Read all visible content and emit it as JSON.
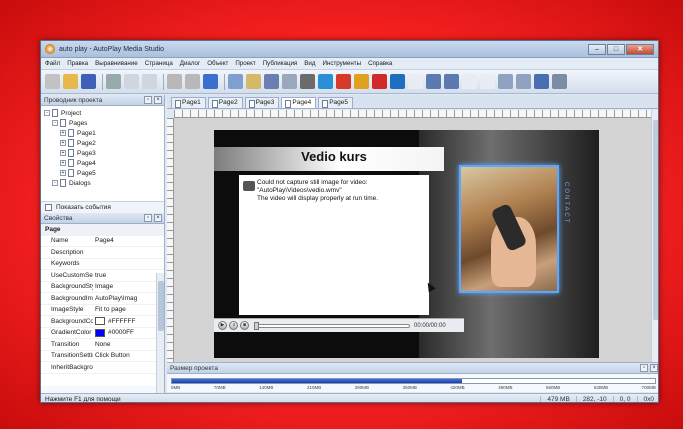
{
  "window": {
    "title": "auto play - AutoPlay Media Studio",
    "controls": {
      "minimize": "–",
      "maximize": "□",
      "close": "✕"
    }
  },
  "menu": [
    "Файл",
    "Правка",
    "Выравнивание",
    "Страница",
    "Диалог",
    "Объект",
    "Проект",
    "Публикация",
    "Вид",
    "Инструменты",
    "Справка"
  ],
  "toolbar_icons": [
    {
      "name": "wand-icon",
      "color": "#c2c2c2"
    },
    {
      "name": "open-folder-icon",
      "color": "#e8b84a"
    },
    {
      "name": "save-icon",
      "color": "#3e60b8"
    },
    {
      "name": "cut-icon",
      "color": "#9aa"
    },
    {
      "name": "copy-icon",
      "color": "#cfd6e0"
    },
    {
      "name": "paste-icon",
      "color": "#cfd6e0"
    },
    {
      "name": "undo-icon",
      "color": "#b8b8b8"
    },
    {
      "name": "redo-icon",
      "color": "#b8b8b8"
    },
    {
      "name": "preview-icon",
      "color": "#3a6fd0"
    },
    {
      "name": "button-object-icon",
      "color": "#7fa0cf"
    },
    {
      "name": "label-object-icon",
      "color": "#d6b86a"
    },
    {
      "name": "text-object-icon",
      "color": "#6a7fb0"
    },
    {
      "name": "paragraph-object-icon",
      "color": "#9aa8bd"
    },
    {
      "name": "plugin-object-icon",
      "color": "#6b6b6b"
    },
    {
      "name": "web-object-icon",
      "color": "#2b8fd8"
    },
    {
      "name": "flash-object-icon",
      "color": "#d83a2a"
    },
    {
      "name": "media-object-icon",
      "color": "#e0a020"
    },
    {
      "name": "pdf-object-icon",
      "color": "#d02a2a"
    },
    {
      "name": "ie-object-icon",
      "color": "#1f6fc0"
    },
    {
      "name": "input-object-icon",
      "color": "#e8edf4"
    },
    {
      "name": "checkbox-object-icon",
      "color": "#5a7ab0"
    },
    {
      "name": "radio-object-icon",
      "color": "#5a7ab0"
    },
    {
      "name": "list-object-icon",
      "color": "#e8edf4"
    },
    {
      "name": "combo-object-icon",
      "color": "#e8edf4"
    },
    {
      "name": "tree-object-icon",
      "color": "#8fa3c0"
    },
    {
      "name": "grid-object-icon",
      "color": "#8fa3c0"
    },
    {
      "name": "progress-object-icon",
      "color": "#4a6fb0"
    },
    {
      "name": "slideshow-object-icon",
      "color": "#7c8ca6"
    }
  ],
  "project_explorer": {
    "header": "Проводник проекта",
    "tree": [
      {
        "label": "Project",
        "level": 0
      },
      {
        "label": "Pages",
        "level": 1
      },
      {
        "label": "Page1",
        "level": 2
      },
      {
        "label": "Page2",
        "level": 2
      },
      {
        "label": "Page3",
        "level": 2
      },
      {
        "label": "Page4",
        "level": 2
      },
      {
        "label": "Page5",
        "level": 2
      },
      {
        "label": "Dialogs",
        "level": 1
      }
    ],
    "show_events": "Показать события"
  },
  "properties": {
    "header": "Свойства",
    "group": "Page",
    "rows": [
      {
        "name": "Name",
        "value": "Page4"
      },
      {
        "name": "Description",
        "value": ""
      },
      {
        "name": "Keywords",
        "value": ""
      },
      {
        "name": "UseCustomSett",
        "value": "true"
      },
      {
        "name": "BackgroundStyl",
        "value": "Image"
      },
      {
        "name": "BackgroundIma",
        "value": "AutoPlay\\Imag"
      },
      {
        "name": "ImageStyle",
        "value": "Fit to page"
      },
      {
        "name": "BackgroundCol",
        "value": "#FFFFFF",
        "swatch": "#FFFFFF"
      },
      {
        "name": "GradientColor",
        "value": "#0000FF",
        "swatch": "#0000FF"
      },
      {
        "name": "Transition",
        "value": "None"
      },
      {
        "name": "TransitionSettin",
        "value": "Click Button"
      },
      {
        "name": "InheritBackgrou",
        "value": ""
      }
    ]
  },
  "tabs": [
    "Page1",
    "Page2",
    "Page3",
    "Page4",
    "Page5"
  ],
  "active_tab": "Page4",
  "page_preview": {
    "title": "Vedio kurs",
    "video_message": [
      "Could not capture still image for video:",
      "\"AutoPlay\\Videos\\vedio.wmv\"",
      "The video will display properly at run time."
    ],
    "time": "00:00/00:00",
    "side_text": "CONTACT"
  },
  "project_size": {
    "header": "Размер проекта",
    "fill_fraction": 0.6,
    "scale": [
      "0MB",
      "70MB",
      "140MB",
      "210MB",
      "280MB",
      "350MB",
      "420MB",
      "490MB",
      "560MB",
      "630MB",
      "700MB"
    ]
  },
  "statusbar": {
    "help": "Нажмите F1 для помощи",
    "size": "479 MB",
    "coords": "282, -10",
    "pos": "0, 0",
    "dim": "0x0"
  }
}
